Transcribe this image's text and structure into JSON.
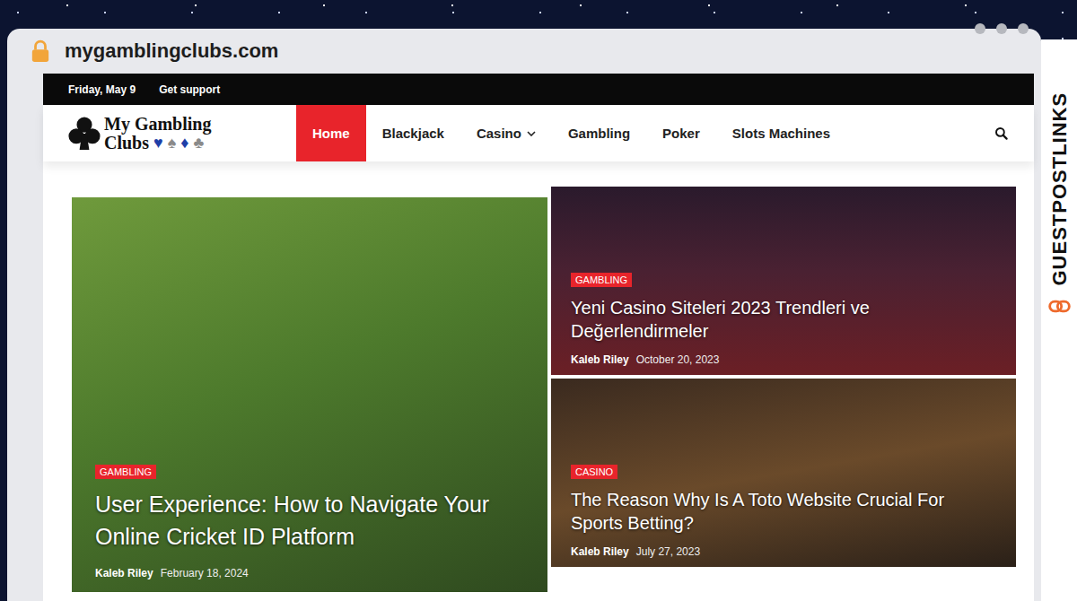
{
  "browser": {
    "url": "mygamblingclubs.com",
    "secure": true
  },
  "top_bar": {
    "date": "Friday, May 9",
    "links": [
      "Get support"
    ]
  },
  "logo": {
    "line1": "My Gambling",
    "line2": "Clubs",
    "suits": [
      {
        "symbol": "♥",
        "color": "#1f3fa8"
      },
      {
        "symbol": "♠",
        "color": "#8a8a8a"
      },
      {
        "symbol": "♦",
        "color": "#1f3fa8"
      },
      {
        "symbol": "♣",
        "color": "#8a8a8a"
      }
    ]
  },
  "nav": [
    {
      "label": "Home",
      "selected": true,
      "has_menu": false
    },
    {
      "label": "Blackjack",
      "selected": false,
      "has_menu": false
    },
    {
      "label": "Casino",
      "selected": false,
      "has_menu": true
    },
    {
      "label": "Gambling",
      "selected": false,
      "has_menu": false
    },
    {
      "label": "Poker",
      "selected": false,
      "has_menu": false
    },
    {
      "label": "Slots Machines",
      "selected": false,
      "has_menu": false
    }
  ],
  "posts": [
    {
      "category": "GAMBLING",
      "title": "User Experience: How to Navigate Your Online Cricket ID Platform",
      "author": "Kaleb Riley",
      "date": "February 18, 2024"
    },
    {
      "category": "GAMBLING",
      "title": "Yeni Casino Siteleri 2023 Trendleri ve Değerlendirmeler",
      "author": "Kaleb Riley",
      "date": "October 20, 2023"
    },
    {
      "category": "CASINO",
      "title": "The Reason Why Is A Toto Website Crucial For Sports Betting?",
      "author": "Kaleb Riley",
      "date": "July 27, 2023"
    }
  ],
  "watermark": {
    "brand": "GUESTPOSTLINKS"
  }
}
